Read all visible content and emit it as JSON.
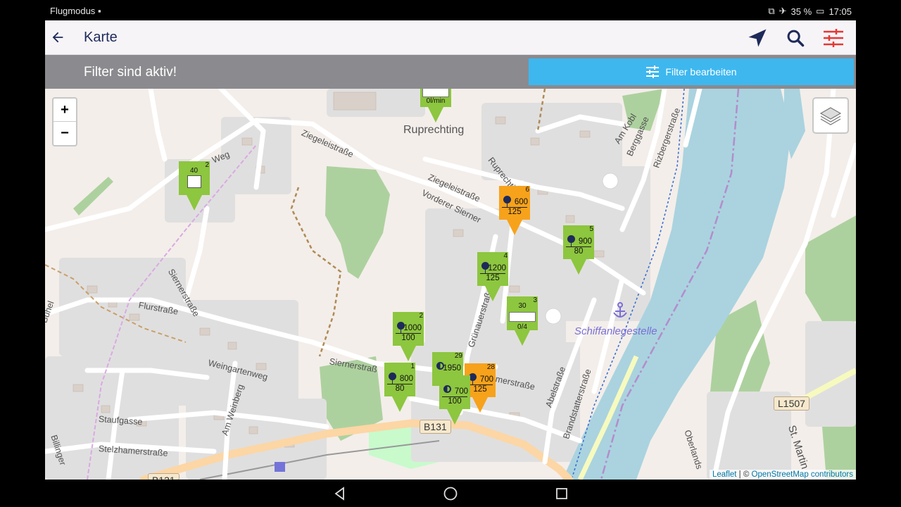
{
  "statusbar": {
    "left_text": "Flugmodus",
    "battery": "35 %",
    "time": "17:05"
  },
  "appbar": {
    "title": "Karte"
  },
  "filterbar": {
    "text": "Filter sind aktiv!",
    "button_label": "Filter bearbeiten"
  },
  "map": {
    "zoom_in": "+",
    "zoom_out": "−",
    "places": {
      "ruprechting": "Ruprechting",
      "schiffanlegestelle": "Schiffanlegestelle"
    },
    "streets": {
      "ziegeleistrasse_1": "Ziegeleistraße",
      "ziegeleistrasse_2": "Ziegeleistraße",
      "vorderer_sierner": "Vorderer Sierner",
      "ruprechting_road": "Ruprechting",
      "am_kobl": "Am Kobl",
      "berggasse": "Berggasse",
      "rizbergerstrasse": "Rizbergerstraße",
      "weg": "Weg",
      "siernerstrasse_1": "Siernerstraße",
      "siernerstrasse_2": "Siernerstraß",
      "flurstrasse": "Flurstraße",
      "weingartenweg": "Weingartenweg",
      "am_weinberg": "Am Weinberg",
      "staufgasse": "Staufgasse",
      "stelzhamerstrasse": "Stelzhamerstraße",
      "grunauerstrasse": "Grünauerstraße",
      "abelstrasse": "Abelstraße",
      "brandstatterstrasse": "Brandstatterstraße",
      "oberlands": "Oberlands",
      "st_martin": "St. Martin",
      "billinger": "Billinger",
      "buhel": "Bühel",
      "merstrasse": "merstraße"
    },
    "shields": {
      "b131": "B131",
      "l1507": "L1507",
      "b131_cut": "B131"
    },
    "markers": [
      {
        "id": "m-top",
        "color": "green",
        "style": "flow",
        "count": "",
        "v1": "",
        "v2": "0l/min"
      },
      {
        "id": "m-weg",
        "color": "green",
        "style": "flow-box",
        "count": "2",
        "v1": "40",
        "v2": ""
      },
      {
        "id": "m-600",
        "color": "orange",
        "style": "tree",
        "count": "6",
        "v1": "600",
        "v2": "125"
      },
      {
        "id": "m-900",
        "color": "green",
        "style": "tree",
        "count": "5",
        "v1": "900",
        "v2": "80"
      },
      {
        "id": "m-1200",
        "color": "green",
        "style": "tree",
        "count": "4",
        "v1": "1200",
        "v2": "125"
      },
      {
        "id": "m-30",
        "color": "green",
        "style": "flow-bar",
        "count": "3",
        "v1": "30",
        "v2": "0/4"
      },
      {
        "id": "m-1000",
        "color": "green",
        "style": "tree",
        "count": "2",
        "v1": "1000",
        "v2": "100"
      },
      {
        "id": "m-1950",
        "color": "green",
        "style": "half",
        "count": "29",
        "v1": "1950",
        "v2": ""
      },
      {
        "id": "m-800",
        "color": "green",
        "style": "tree",
        "count": "1",
        "v1": "800",
        "v2": "80"
      },
      {
        "id": "m-700o",
        "color": "orange",
        "style": "tree",
        "count": "28",
        "v1": "700",
        "v2": "125"
      },
      {
        "id": "m-700g",
        "color": "green",
        "style": "half",
        "count": "",
        "v1": "700",
        "v2": "100"
      }
    ],
    "attribution": {
      "leaflet": "Leaflet",
      "sep": " | © ",
      "osm": "OpenStreetMap contributors"
    }
  },
  "colors": {
    "accent_blue": "#3eb7ef",
    "navy": "#1e2a5a",
    "filter_red": "#e53935",
    "marker_green": "#8dc63f",
    "marker_orange": "#f7a21b",
    "river": "#aad3df"
  }
}
